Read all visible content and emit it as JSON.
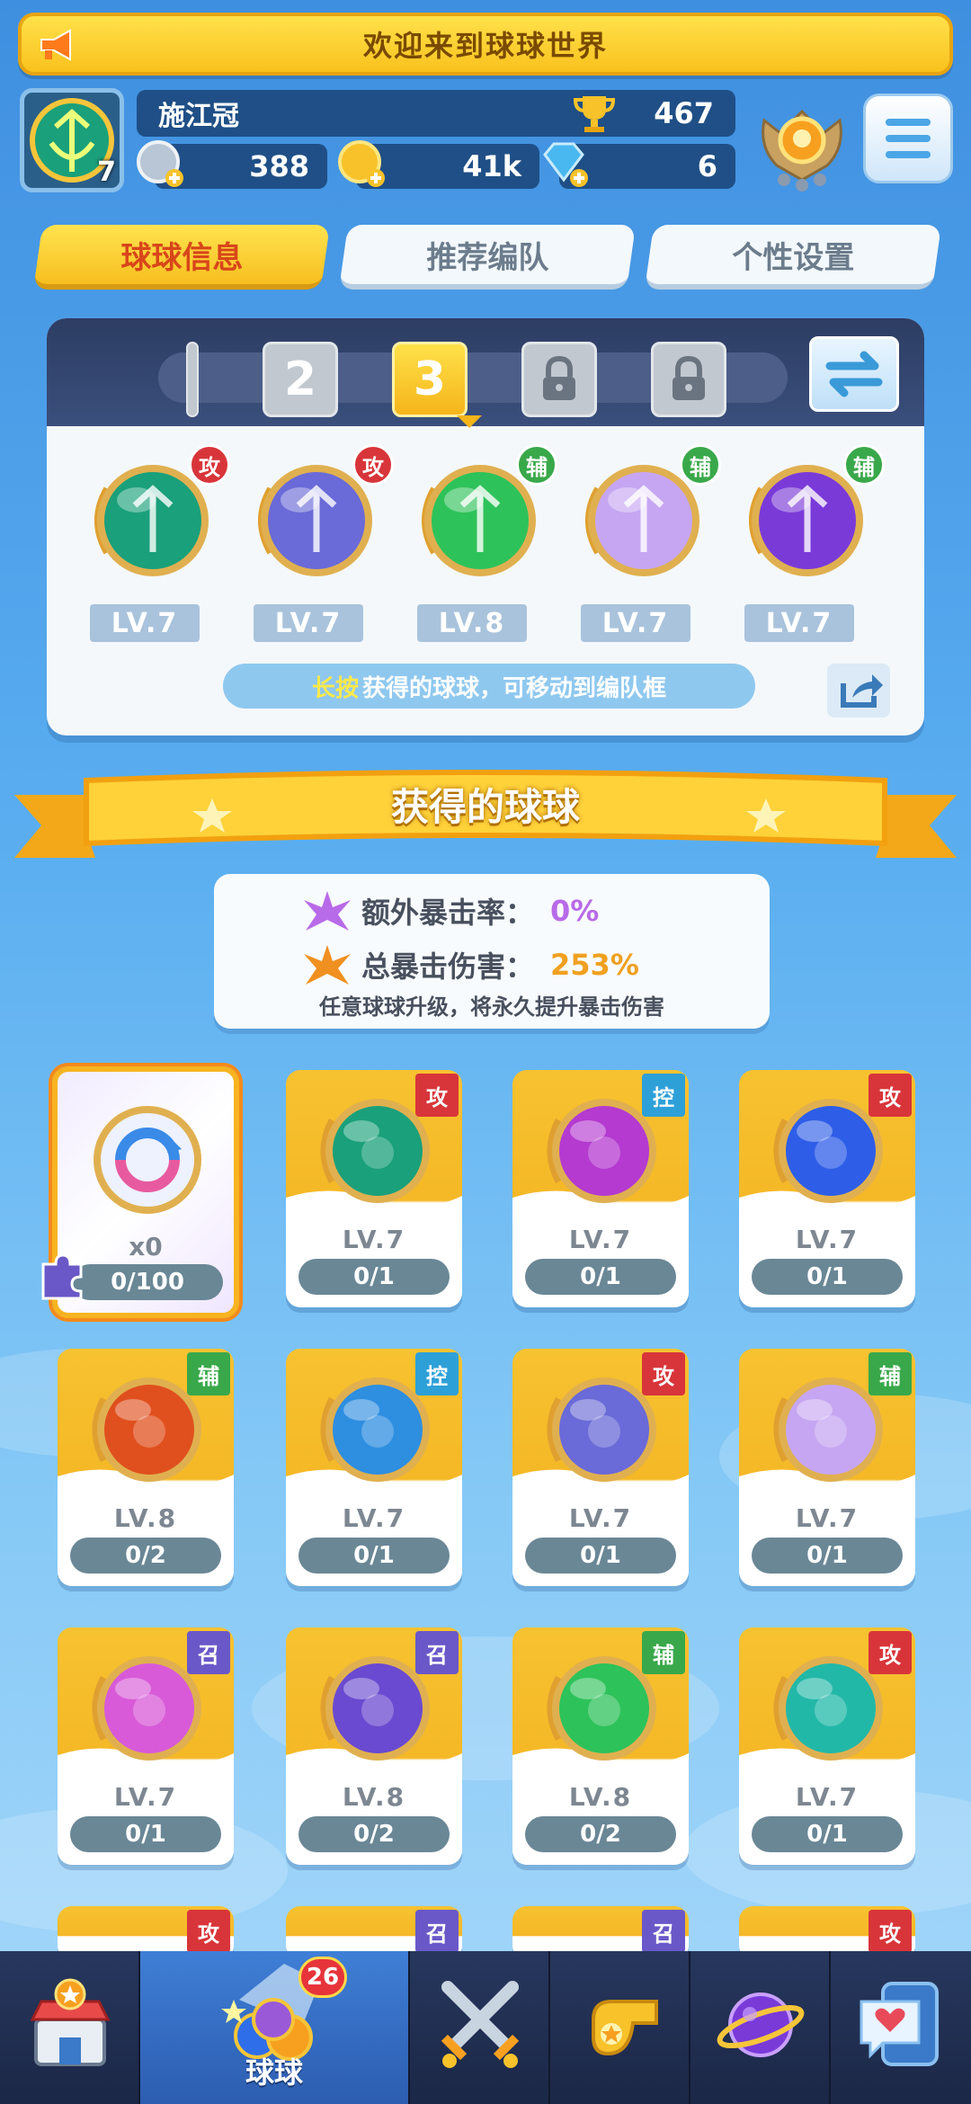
{
  "banner": {
    "text": "欢迎来到球球世界"
  },
  "profile": {
    "name": "施江冠",
    "level": "7",
    "trophies": "467",
    "silver": "388",
    "coins": "41k",
    "gems": "6"
  },
  "tabs": [
    {
      "label": "球球信息",
      "active": true
    },
    {
      "label": "推荐编队",
      "active": false
    },
    {
      "label": "个性设置",
      "active": false
    }
  ],
  "team": {
    "slots": [
      "2",
      "3"
    ],
    "balls": [
      {
        "tag": "攻",
        "lv": "LV.7",
        "color": "#1aa07a"
      },
      {
        "tag": "攻",
        "lv": "LV.7",
        "color": "#6a6ad8"
      },
      {
        "tag": "辅",
        "lv": "LV.8",
        "color": "#2ec25a"
      },
      {
        "tag": "辅",
        "lv": "LV.7",
        "color": "#c6a6f2"
      },
      {
        "tag": "辅",
        "lv": "LV.7",
        "color": "#7a3ad8"
      }
    ],
    "hint_highlight": "长按",
    "hint_text": "获得的球球，可移动到编队框"
  },
  "collection": {
    "title": "获得的球球",
    "crit_rate_label": "额外暴击率：",
    "crit_rate_value": "0%",
    "crit_damage_label": "总暴击伤害：",
    "crit_damage_value": "253%",
    "note": "任意球球升级，将永久提升暴击伤害"
  },
  "special_card": {
    "count": "x0",
    "progress": "0/100"
  },
  "cards": [
    {
      "tag": "攻",
      "lv": "LV.7",
      "progress": "0/1",
      "color": "#1aa07a"
    },
    {
      "tag": "控",
      "lv": "LV.7",
      "progress": "0/1",
      "color": "#b43ad0"
    },
    {
      "tag": "攻",
      "lv": "LV.7",
      "progress": "0/1",
      "color": "#2e5ee8"
    },
    {
      "tag": "辅",
      "lv": "LV.8",
      "progress": "0/2",
      "color": "#e0501e"
    },
    {
      "tag": "控",
      "lv": "LV.7",
      "progress": "0/1",
      "color": "#2e8ee0"
    },
    {
      "tag": "攻",
      "lv": "LV.7",
      "progress": "0/1",
      "color": "#6a6ad8"
    },
    {
      "tag": "辅",
      "lv": "LV.7",
      "progress": "0/1",
      "color": "#c6a6f2"
    },
    {
      "tag": "召",
      "lv": "LV.7",
      "progress": "0/1",
      "color": "#d85ad8"
    },
    {
      "tag": "召",
      "lv": "LV.8",
      "progress": "0/2",
      "color": "#6a4ad0"
    },
    {
      "tag": "辅",
      "lv": "LV.8",
      "progress": "0/2",
      "color": "#2ec25a"
    },
    {
      "tag": "攻",
      "lv": "LV.7",
      "progress": "0/1",
      "color": "#22b8a8"
    }
  ],
  "partial_cards": [
    "攻",
    "召",
    "召",
    "攻"
  ],
  "nav": {
    "items": [
      "shop",
      "balls",
      "battle",
      "whistle",
      "planet",
      "chat"
    ],
    "active_label": "球球",
    "badge": "26"
  }
}
